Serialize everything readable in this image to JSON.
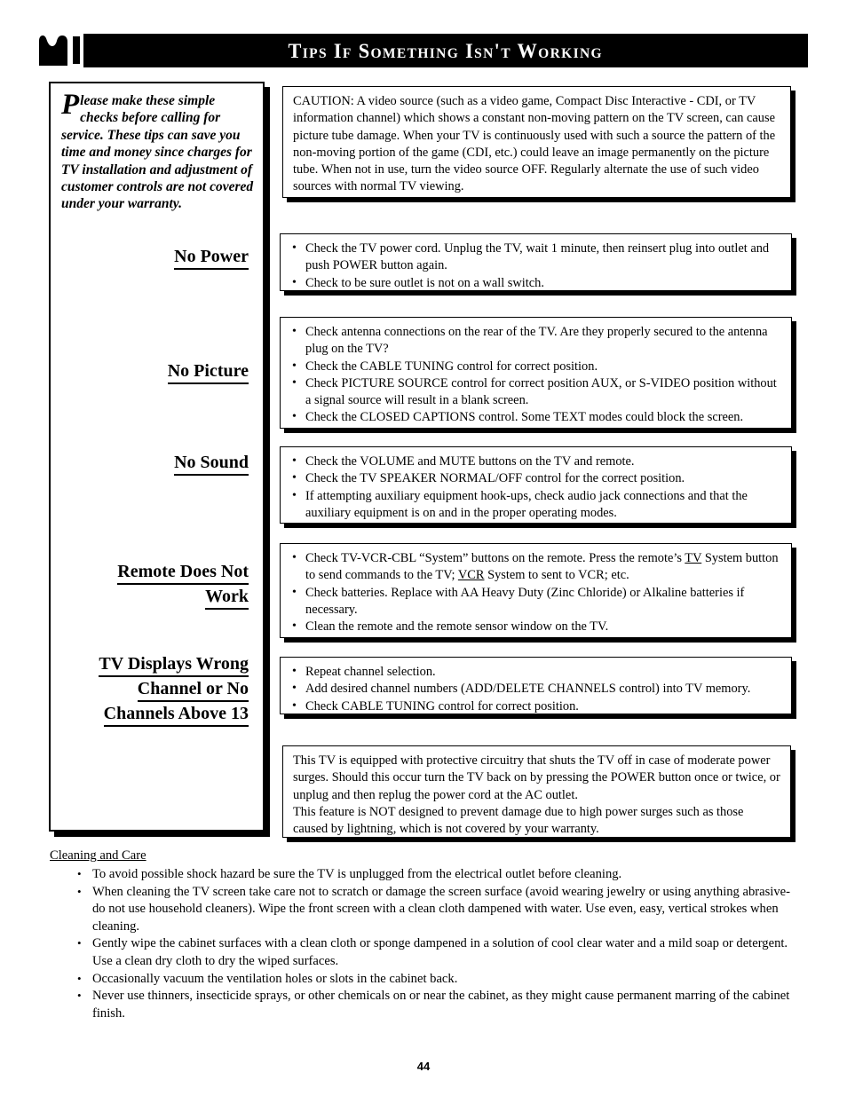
{
  "header": {
    "logo_icon": "philips-crown-logo-icon",
    "title": "Tips If Something Isn't Working"
  },
  "sidebar": {
    "intro_dropcap": "P",
    "intro_text": "lease make these simple checks before calling for service.  These tips can save you time and money since charges for TV installation and adjustment of customer controls are not covered under your warranty."
  },
  "sections": [
    {
      "heading_lines": [
        "No Power"
      ],
      "bullets": [
        "Check the TV power cord. Unplug the TV, wait 1 minute, then reinsert plug into outlet and push POWER button again.",
        "Check to be sure outlet is not on a wall switch."
      ]
    },
    {
      "heading_lines": [
        "No Picture"
      ],
      "bullets": [
        "Check antenna connections on the rear of the TV. Are they properly secured to the antenna plug on the TV?",
        "Check the CABLE TUNING control for correct position.",
        "Check PICTURE SOURCE control for correct position AUX, or S-VIDEO position without a signal source will result in a blank screen.",
        "Check the CLOSED CAPTIONS control. Some TEXT modes could block the screen."
      ]
    },
    {
      "heading_lines": [
        "No Sound"
      ],
      "bullets": [
        "Check the VOLUME and MUTE buttons on the TV and remote.",
        "Check the TV SPEAKER NORMAL/OFF control for the correct position.",
        "If attempting auxiliary equipment hook-ups, check audio jack connections and that the auxiliary equipment is on and in the proper operating modes."
      ]
    },
    {
      "heading_lines": [
        "Remote Does Not",
        "Work"
      ],
      "bullets": [
        "Check TV-VCR-CBL “System” buttons on the remote. Press the remote’s TV System button to send commands to the TV; VCR System to sent to VCR; etc.",
        "Check batteries.  Replace with AA Heavy Duty (Zinc Chloride) or Alkaline batteries if necessary.",
        "Clean the remote and the remote sensor window on the TV."
      ]
    },
    {
      "heading_lines": [
        "TV Displays Wrong",
        "Channel or No",
        "Channels Above 13"
      ],
      "bullets": [
        "Repeat channel selection.",
        "Add desired channel numbers (ADD/DELETE CHANNELS control) into TV memory.",
        "Check CABLE TUNING control for correct position."
      ]
    }
  ],
  "caution_box": {
    "text": "CAUTION: A video source (such as a video game, Compact Disc Interactive - CDI, or TV information channel) which shows a constant non-moving pattern on the TV screen, can cause picture tube damage. When your TV is continuously used with such a source the pattern of the non-moving portion of the game (CDI, etc.) could leave an image permanently on the picture tube. When not in use, turn the video source OFF. Regularly alternate the use of such video sources with normal TV viewing."
  },
  "surge_box": {
    "paragraph_1": "This TV is equipped with protective circuitry that shuts the TV off in case of moderate power surges. Should this occur turn the TV back on by pressing the POWER button once or twice, or unplug and then replug the power cord at the AC outlet.",
    "paragraph_2": "This feature is NOT designed to prevent damage due to high power surges such as those caused by lightning, which is not covered by your warranty."
  },
  "care": {
    "title": "Cleaning and Care",
    "items": [
      "To avoid possible shock hazard be sure the TV is unplugged from the electrical outlet before cleaning.",
      "When cleaning the TV screen take care not to scratch or damage the screen surface (avoid wearing jewelry or using anything abrasive- do not use household cleaners). Wipe the front screen with a clean cloth dampened with water.  Use even, easy, vertical strokes when cleaning.",
      "Gently wipe the cabinet surfaces with a clean cloth or sponge dampened in a solution of cool clear water and a mild soap or detergent. Use a clean dry cloth to dry the wiped surfaces.",
      "Occasionally vacuum the ventilation holes or slots in the cabinet back.",
      "Never use thinners, insecticide sprays, or other chemicals on or near the cabinet, as they might cause permanent marring of the cabinet finish."
    ]
  },
  "footer": {
    "page_number": "44"
  },
  "colors": {
    "banner_background": "#000000",
    "banner_text": "#ffffff",
    "page_background": "#ffffff",
    "ink": "#000000"
  }
}
